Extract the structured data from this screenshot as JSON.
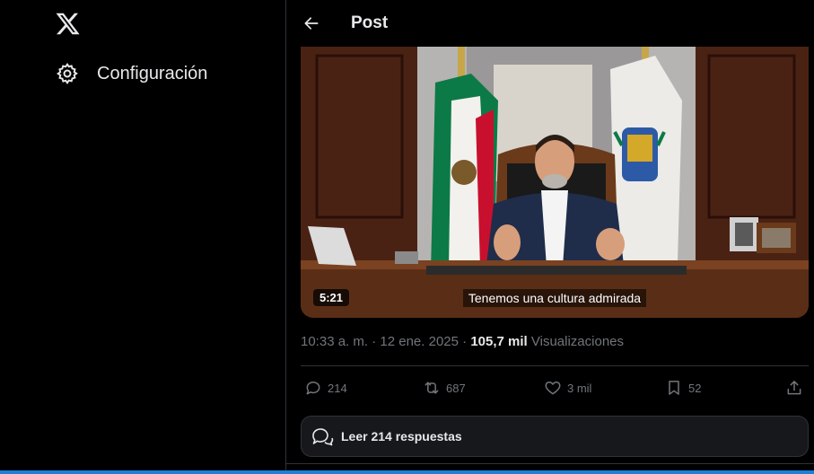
{
  "sidebar": {
    "logo_icon": "x-logo-icon",
    "settings_icon": "gear-icon",
    "settings_label": "Configuración"
  },
  "header": {
    "back_icon": "arrow-left-icon",
    "title": "Post"
  },
  "video": {
    "duration": "5:21",
    "caption": "Tenemos una cultura admirada"
  },
  "meta": {
    "time": "10:33 a. m.",
    "separator1": " · ",
    "date": "12 ene. 2025",
    "separator2": " · ",
    "views_count": "105,7 mil",
    "views_label": "Visualizaciones"
  },
  "actions": {
    "reply_count": "214",
    "repost_count": "687",
    "like_count": "3 mil",
    "bookmark_count": "52"
  },
  "replies_button": {
    "label": "Leer 214 respuestas"
  },
  "colors": {
    "background": "#000000",
    "text": "#e7e9ea",
    "muted": "#71767b",
    "border": "#2f3336",
    "accent": "#1d9bf0"
  }
}
